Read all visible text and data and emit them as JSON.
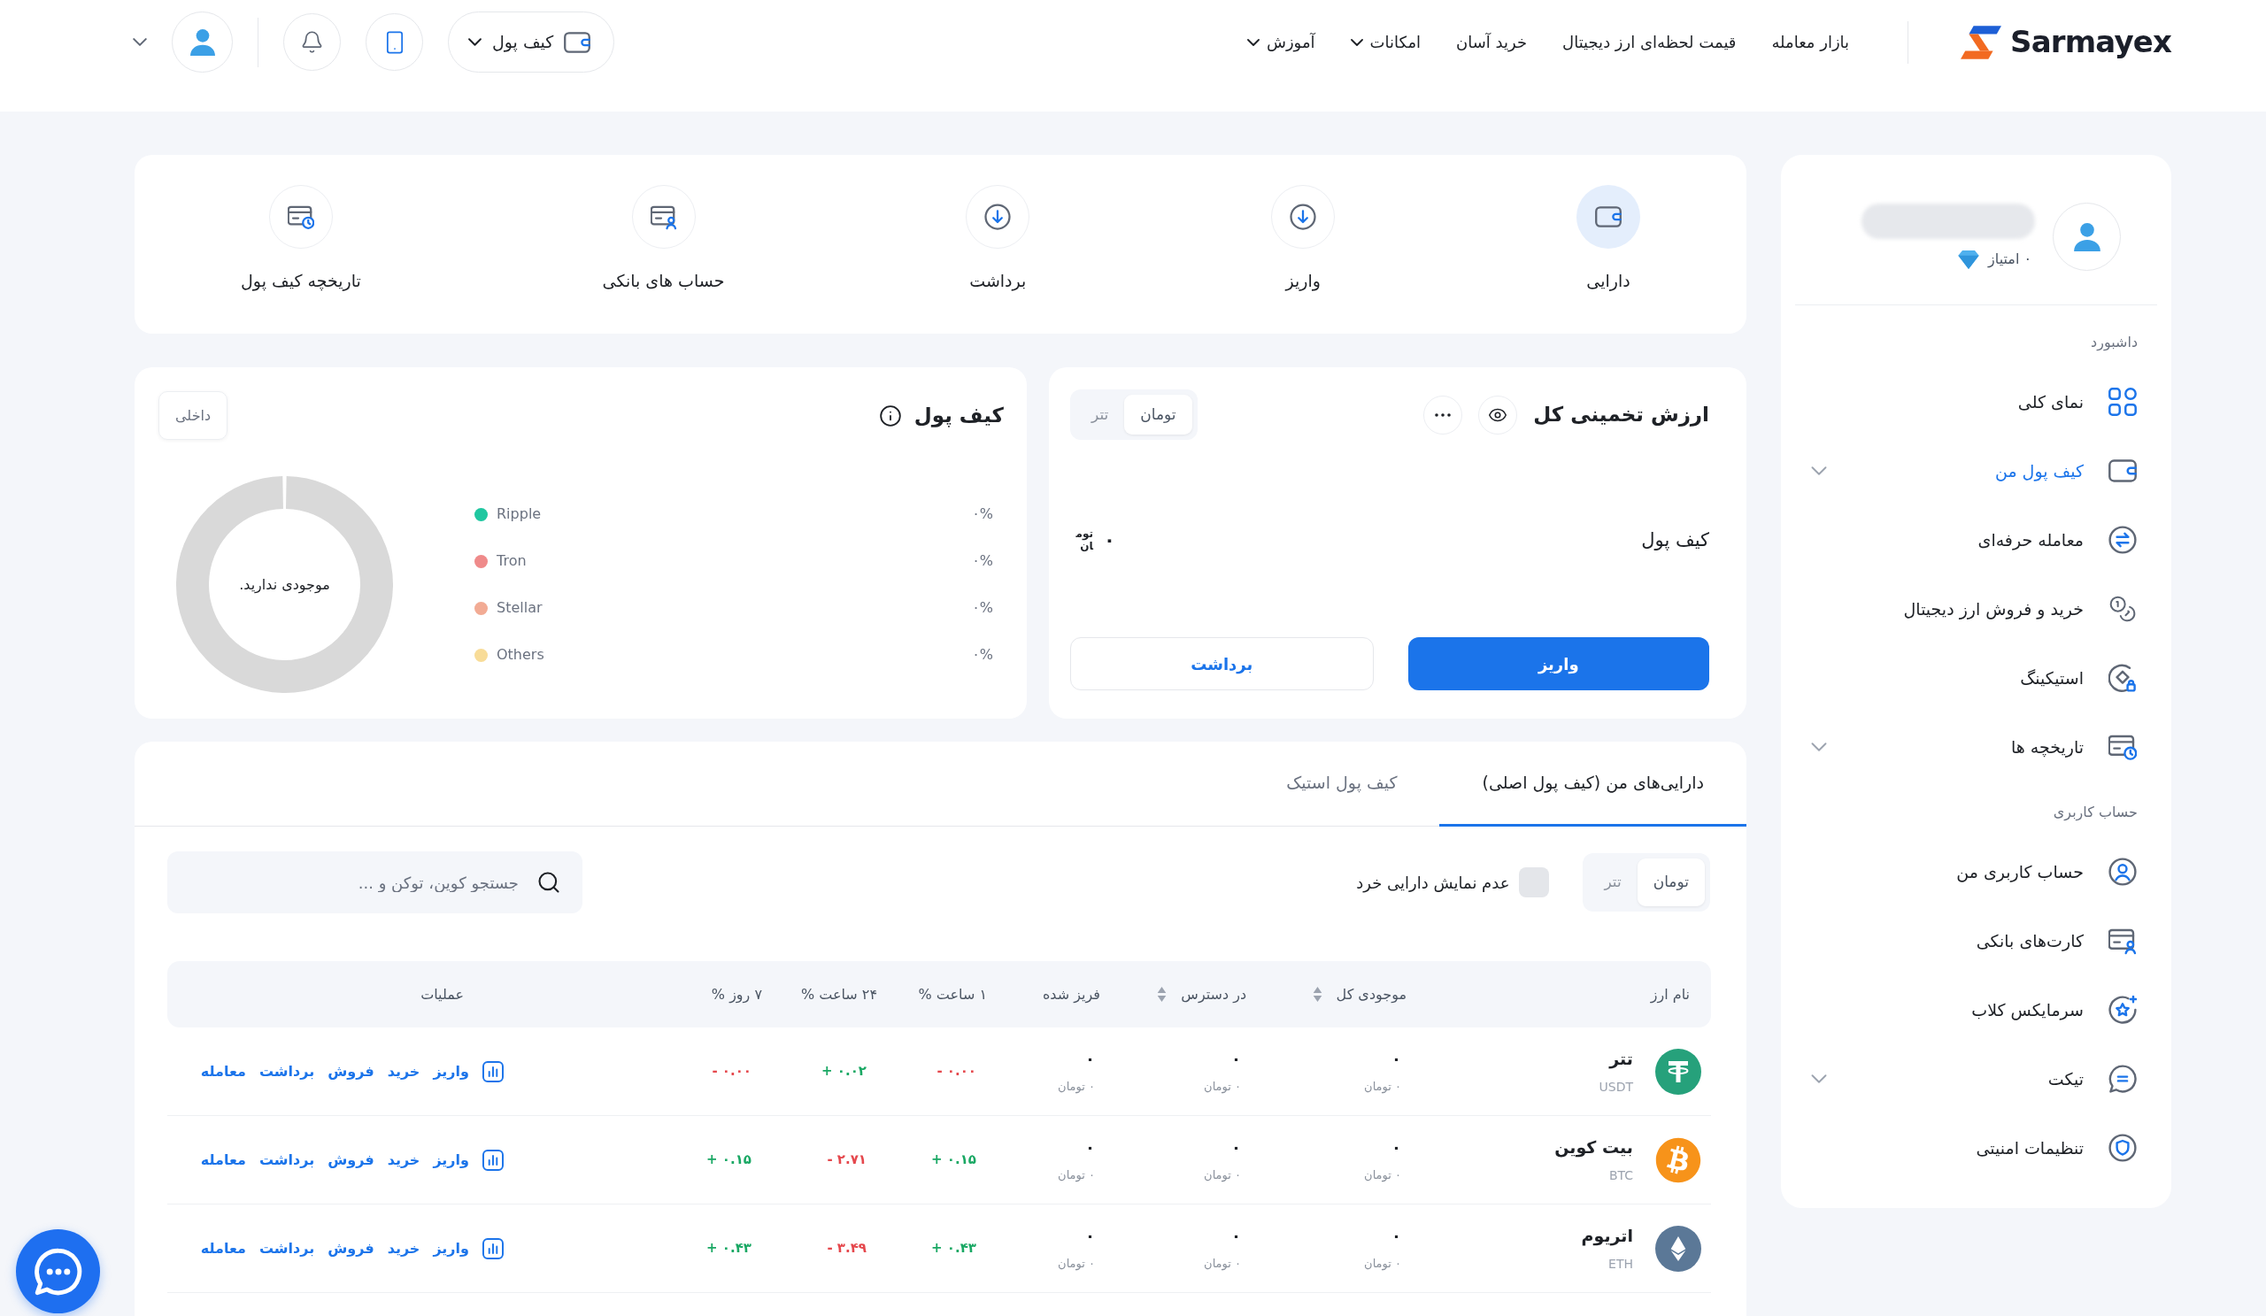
{
  "header": {
    "logo": "Sarmayex",
    "nav": [
      {
        "label": "بازار معامله",
        "dropdown": false
      },
      {
        "label": "قیمت لحظه‌ای ارز دیجیتال",
        "dropdown": false
      },
      {
        "label": "خرید آسان",
        "dropdown": false
      },
      {
        "label": "امکانات",
        "dropdown": true
      },
      {
        "label": "آموزش",
        "dropdown": true
      }
    ],
    "wallet_button": "کیف پول"
  },
  "sidebar": {
    "points": "۰ امتیاز",
    "sections": [
      {
        "title": "داشبورد",
        "items": [
          {
            "label": "نمای کلی",
            "selected": false,
            "expandable": false
          },
          {
            "label": "کیف پول من",
            "selected": true,
            "expandable": true
          },
          {
            "label": "معامله حرفه‌ای",
            "selected": false,
            "expandable": false
          },
          {
            "label": "خرید و فروش ارز دیجیتال",
            "selected": false,
            "expandable": false
          },
          {
            "label": "استیکینگ",
            "selected": false,
            "expandable": false
          },
          {
            "label": "تاریخچه ها",
            "selected": false,
            "expandable": true
          }
        ]
      },
      {
        "title": "حساب کاربری",
        "items": [
          {
            "label": "حساب کاربری من",
            "selected": false,
            "expandable": false
          },
          {
            "label": "کارت‌های بانکی",
            "selected": false,
            "expandable": false
          },
          {
            "label": "سرمایکس کلاب",
            "selected": false,
            "expandable": false
          },
          {
            "label": "تیکت",
            "selected": false,
            "expandable": true
          },
          {
            "label": "تنظیمات امنیتی",
            "selected": false,
            "expandable": false
          }
        ]
      }
    ]
  },
  "actions": [
    {
      "label": "دارایی",
      "selected": true
    },
    {
      "label": "واریز",
      "selected": false
    },
    {
      "label": "برداشت",
      "selected": false
    },
    {
      "label": "حساب های بانکی",
      "selected": false
    },
    {
      "label": "تاریخچه کیف پول",
      "selected": false
    }
  ],
  "estimated_value": {
    "title": "ارزش تخمینی کل",
    "currency_toggle": [
      {
        "label": "تومان",
        "selected": true
      },
      {
        "label": "تتر",
        "selected": false
      }
    ],
    "wallet_label": "کیف پول",
    "value": "۰",
    "unit": "تومان",
    "deposit_button": "واریز",
    "withdraw_button": "برداشت"
  },
  "wallet_chart": {
    "title": "کیف پول",
    "badge": "داخلی",
    "empty_text": "موجودی ندارید.",
    "legend": [
      {
        "name": "Ripple",
        "color": "#1fc7a0",
        "percent": "۰%"
      },
      {
        "name": "Tron",
        "color": "#ef8a8a",
        "percent": "۰%"
      },
      {
        "name": "Stellar",
        "color": "#f2ab94",
        "percent": "۰%"
      },
      {
        "name": "Others",
        "color": "#f8dc98",
        "percent": "۰%"
      }
    ]
  },
  "assets": {
    "tabs": [
      {
        "label": "دارایی‌های من (کیف پول اصلی)",
        "selected": true
      },
      {
        "label": "کیف پول استیک",
        "selected": false
      }
    ],
    "currency_toggle": [
      {
        "label": "تومان",
        "selected": true
      },
      {
        "label": "تتر",
        "selected": false
      }
    ],
    "hide_small": {
      "label": "عدم نمایش دارایی خرد",
      "checked": false
    },
    "search": {
      "placeholder": "جستجو کوین، توکن و ..."
    },
    "columns": [
      {
        "label": "نام ارز",
        "sortable": false
      },
      {
        "label": "موجودی کل",
        "sortable": true
      },
      {
        "label": "در دسترس",
        "sortable": true
      },
      {
        "label": "فریز شده",
        "sortable": false
      },
      {
        "label": "۱ ساعت %",
        "sortable": false
      },
      {
        "label": "۲۴ ساعت %",
        "sortable": false
      },
      {
        "label": "۷ روز %",
        "sortable": false
      },
      {
        "label": "عملیات",
        "sortable": false
      }
    ],
    "rows": [
      {
        "name": "تتر",
        "symbol": "USDT",
        "total": {
          "amount": "۰",
          "toman": "۰ تومان"
        },
        "available": {
          "amount": "۰",
          "toman": "۰ تومان"
        },
        "frozen": {
          "amount": "۰",
          "toman": "۰ تومان"
        },
        "change_1h": {
          "text": "- ۰.۰۰",
          "color": "#e5484d"
        },
        "change_24h": {
          "text": "+ ۰.۰۲",
          "color": "#1aa864"
        },
        "change_7d": {
          "text": "- ۰.۰۰",
          "color": "#e5484d"
        },
        "actions": [
          "واریز",
          "خرید",
          "فروش",
          "برداشت",
          "معامله"
        ]
      },
      {
        "name": "بیت کوین",
        "symbol": "BTC",
        "total": {
          "amount": "۰",
          "toman": "۰ تومان"
        },
        "available": {
          "amount": "۰",
          "toman": "۰ تومان"
        },
        "frozen": {
          "amount": "۰",
          "toman": "۰ تومان"
        },
        "change_1h": {
          "text": "+ ۰.۱۵",
          "color": "#1aa864"
        },
        "change_24h": {
          "text": "- ۲.۷۱",
          "color": "#e5484d"
        },
        "change_7d": {
          "text": "+ ۰.۱۵",
          "color": "#1aa864"
        },
        "actions": [
          "واریز",
          "خرید",
          "فروش",
          "برداشت",
          "معامله"
        ]
      },
      {
        "name": "اتریوم",
        "symbol": "ETH",
        "total": {
          "amount": "۰",
          "toman": "۰ تومان"
        },
        "available": {
          "amount": "۰",
          "toman": "۰ تومان"
        },
        "frozen": {
          "amount": "۰",
          "toman": "۰ تومان"
        },
        "change_1h": {
          "text": "+ ۰.۴۳",
          "color": "#1aa864"
        },
        "change_24h": {
          "text": "- ۳.۴۹",
          "color": "#e5484d"
        },
        "change_7d": {
          "text": "+ ۰.۴۳",
          "color": "#1aa864"
        },
        "actions": [
          "واریز",
          "خرید",
          "فروش",
          "برداشت",
          "معامله"
        ]
      }
    ]
  }
}
